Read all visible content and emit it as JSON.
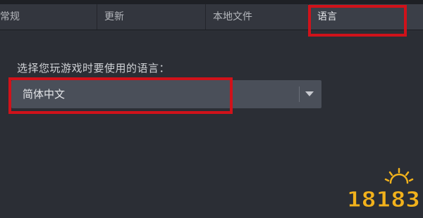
{
  "tabs": [
    {
      "label": "常规",
      "active": false
    },
    {
      "label": "更新",
      "active": false
    },
    {
      "label": "本地文件",
      "active": false
    },
    {
      "label": "语言",
      "active": true
    }
  ],
  "language": {
    "prompt": "选择您玩游戏时要使用的语言：",
    "selected": "简体中文"
  },
  "watermark": {
    "text": "18183"
  },
  "colors": {
    "background": "#2b2e35",
    "highlight": "#d0121a",
    "dropdown": "#4a4f59",
    "watermark": "#f2b21c"
  }
}
